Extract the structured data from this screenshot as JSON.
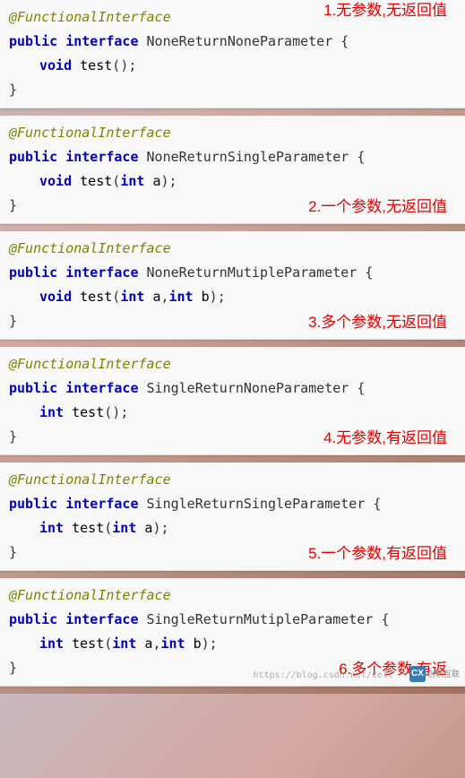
{
  "blocks": [
    {
      "annotation": "@FunctionalInterface",
      "modifiers1": "public",
      "modifiers2": "interface",
      "name": "NoneReturnNoneParameter",
      "return_type": "void",
      "method": "test",
      "params_raw": "()",
      "caption": "1.无参数,无返回值",
      "caption_bottom": "92px"
    },
    {
      "annotation": "@FunctionalInterface",
      "modifiers1": "public",
      "modifiers2": "interface",
      "name": "NoneReturnSingleParameter",
      "return_type": "void",
      "method": "test",
      "params_type": "int",
      "params_var": "a",
      "caption": "2.一个参数,无返回值",
      "caption_bottom": "2px"
    },
    {
      "annotation": "@FunctionalInterface",
      "modifiers1": "public",
      "modifiers2": "interface",
      "name": "NoneReturnMutipleParameter",
      "name_warn": true,
      "return_type": "void",
      "method": "test",
      "params_type1": "int",
      "params_var1": "a",
      "params_type2": "int",
      "params_var2": "b",
      "caption": "3.多个参数,无返回值",
      "caption_bottom": "2px"
    },
    {
      "annotation": "@FunctionalInterface",
      "modifiers1": "public",
      "modifiers2": "interface",
      "name": "SingleReturnNoneParameter",
      "return_type": "int",
      "method": "test",
      "params_raw": "()",
      "caption": "4.无参数,有返回值",
      "caption_bottom": "2px"
    },
    {
      "annotation": "@FunctionalInterface",
      "modifiers1": "public",
      "modifiers2": "interface",
      "name": "SingleReturnSingleParameter",
      "return_type": "int",
      "method": "test",
      "params_type": "int",
      "params_var": "a",
      "caption": "5.一个参数,有返回值",
      "caption_bottom": "2px"
    },
    {
      "annotation": "@FunctionalInterface",
      "modifiers1": "public",
      "modifiers2": "interface",
      "name": "SingleReturnMutipleParameter",
      "name_warn": true,
      "return_type": "int",
      "method": "test",
      "params_type1": "int",
      "params_var1": "a",
      "params_type2": "int",
      "params_var2": "b",
      "caption": "6.多个参数,有返",
      "caption_bottom": "2px",
      "watermark": "https://blog.csdn.net/cell",
      "logo_char": "CX",
      "logo_text": "创新互联"
    }
  ]
}
